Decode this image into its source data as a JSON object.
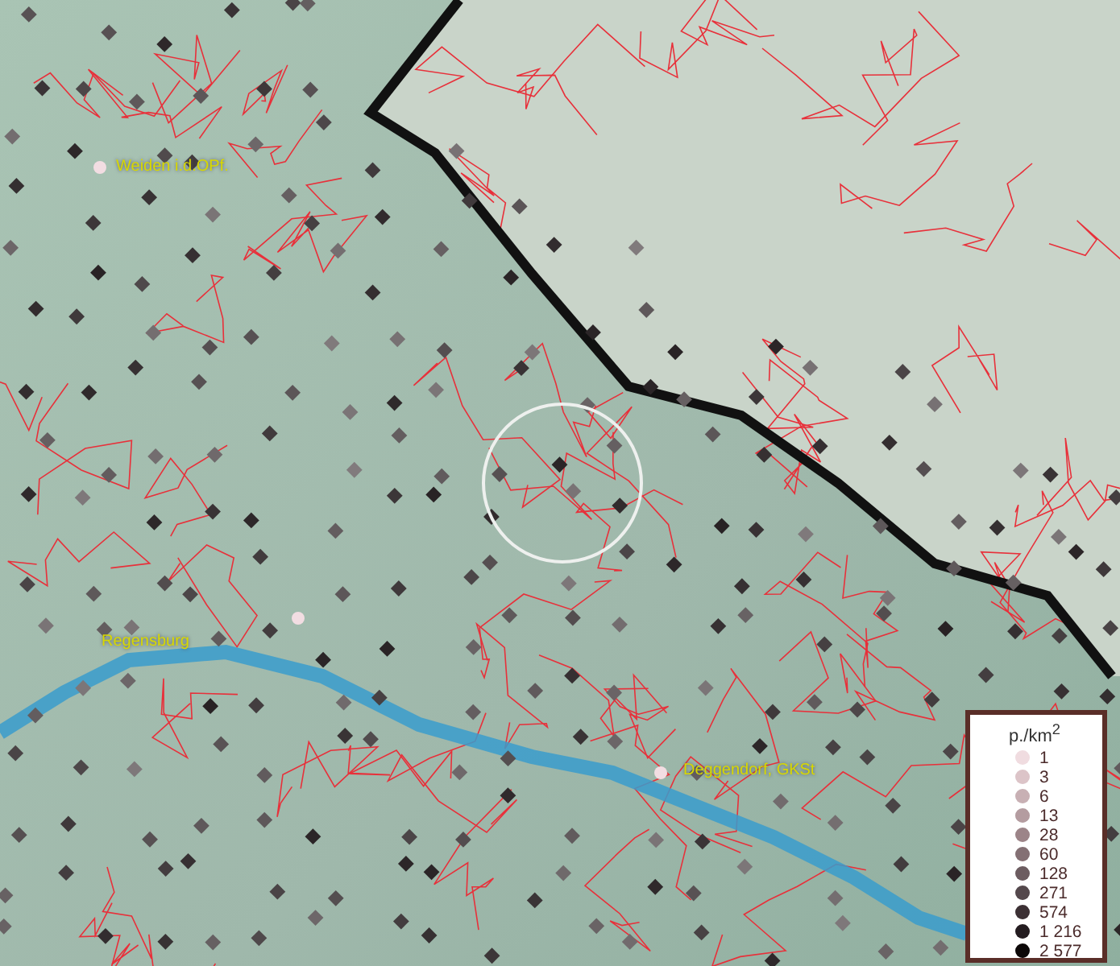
{
  "map": {
    "places": [
      {
        "name": "Weiden i.d.OPf."
      },
      {
        "name": "Regensburg"
      },
      {
        "name": "Deggendorf, GKSt"
      }
    ]
  },
  "legend": {
    "title": "p./km$^{2}$",
    "items": [
      {
        "label": "1",
        "color": "#f0dce0"
      },
      {
        "label": "3",
        "color": "#dcc4c8"
      },
      {
        "label": "6",
        "color": "#c8b0b4"
      },
      {
        "label": "13",
        "color": "#b49ca0"
      },
      {
        "label": "28",
        "color": "#9c8488"
      },
      {
        "label": "60",
        "color": "#847074"
      },
      {
        "label": "128",
        "color": "#6c5c60"
      },
      {
        "label": "271",
        "color": "#54484c"
      },
      {
        "label": "574",
        "color": "#3c3034"
      },
      {
        "label": "1 216",
        "color": "#241c20"
      },
      {
        "label": "2 577",
        "color": "#0c0808"
      }
    ]
  }
}
